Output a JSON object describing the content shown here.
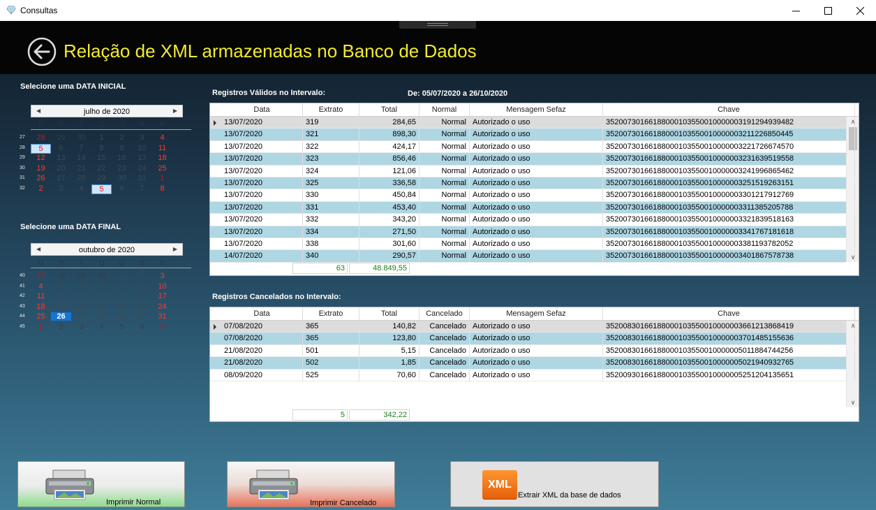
{
  "window": {
    "title": "Consultas",
    "controls": [
      "minimize",
      "maximize",
      "close"
    ]
  },
  "header": {
    "title": "Relação de XML armazenadas no Banco de Dados",
    "back_icon": "arrow-left-circle-icon"
  },
  "calendar_start": {
    "label": "Selecione uma DATA INICIAL",
    "month_title": "julho de 2020",
    "weekday_headers": [
      "D",
      "S",
      "T",
      "Q",
      "Q",
      "S",
      "S"
    ],
    "weeks": [
      {
        "week": "27",
        "days": [
          "28",
          "29",
          "30",
          "1",
          "2",
          "3",
          "4"
        ]
      },
      {
        "week": "28",
        "days": [
          "5",
          "6",
          "7",
          "8",
          "9",
          "10",
          "11"
        ]
      },
      {
        "week": "29",
        "days": [
          "12",
          "13",
          "14",
          "15",
          "16",
          "17",
          "18"
        ]
      },
      {
        "week": "30",
        "days": [
          "19",
          "20",
          "21",
          "22",
          "23",
          "24",
          "25"
        ]
      },
      {
        "week": "31",
        "days": [
          "26",
          "27",
          "28",
          "29",
          "30",
          "31",
          "1"
        ]
      },
      {
        "week": "32",
        "days": [
          "2",
          "3",
          "4",
          "5",
          "6",
          "7",
          "8"
        ]
      }
    ],
    "selected_day": "5"
  },
  "calendar_end": {
    "label": "Selecione uma DATA FINAL",
    "month_title": "outubro de 2020",
    "weekday_headers": [
      "D",
      "S",
      "T",
      "Q",
      "Q",
      "S",
      "S"
    ],
    "weeks": [
      {
        "week": "40",
        "days": [
          "27",
          "28",
          "29",
          "30",
          "1",
          "2",
          "3"
        ]
      },
      {
        "week": "41",
        "days": [
          "4",
          "5",
          "6",
          "7",
          "8",
          "9",
          "10"
        ]
      },
      {
        "week": "42",
        "days": [
          "11",
          "12",
          "13",
          "14",
          "15",
          "16",
          "17"
        ]
      },
      {
        "week": "43",
        "days": [
          "18",
          "19",
          "20",
          "21",
          "22",
          "23",
          "24"
        ]
      },
      {
        "week": "44",
        "days": [
          "25",
          "26",
          "27",
          "28",
          "29",
          "30",
          "31"
        ]
      },
      {
        "week": "45",
        "days": [
          "1",
          "2",
          "3",
          "4",
          "5",
          "6",
          "7"
        ]
      }
    ],
    "selected_day": "26"
  },
  "valid_section": {
    "label": "Registros Válidos no Intervalo:",
    "range": "De: 05/07/2020 a 26/10/2020",
    "columns": [
      "Data",
      "Extrato",
      "Total",
      "Normal",
      "Mensagem Sefaz",
      "Chave"
    ],
    "rows": [
      [
        "13/07/2020",
        "319",
        "284,65",
        "Normal",
        "Autorizado o uso",
        "35200730166188000103550010000003191294939482"
      ],
      [
        "13/07/2020",
        "321",
        "898,30",
        "Normal",
        "Autorizado o uso",
        "35200730166188000103550010000003211226850445"
      ],
      [
        "13/07/2020",
        "322",
        "424,17",
        "Normal",
        "Autorizado o uso",
        "35200730166188000103550010000003221726674570"
      ],
      [
        "13/07/2020",
        "323",
        "856,46",
        "Normal",
        "Autorizado o uso",
        "35200730166188000103550010000003231639519558"
      ],
      [
        "13/07/2020",
        "324",
        "121,06",
        "Normal",
        "Autorizado o uso",
        "35200730166188000103550010000003241996865462"
      ],
      [
        "13/07/2020",
        "325",
        "336,58",
        "Normal",
        "Autorizado o uso",
        "35200730166188000103550010000003251519263151"
      ],
      [
        "13/07/2020",
        "330",
        "450,84",
        "Normal",
        "Autorizado o uso",
        "35200730166188000103550010000003301217912769"
      ],
      [
        "13/07/2020",
        "331",
        "453,40",
        "Normal",
        "Autorizado o uso",
        "35200730166188000103550010000003311385205788"
      ],
      [
        "13/07/2020",
        "332",
        "343,20",
        "Normal",
        "Autorizado o uso",
        "35200730166188000103550010000003321839518163"
      ],
      [
        "13/07/2020",
        "334",
        "271,50",
        "Normal",
        "Autorizado o uso",
        "35200730166188000103550010000003341767181618"
      ],
      [
        "13/07/2020",
        "338",
        "301,60",
        "Normal",
        "Autorizado o uso",
        "35200730166188000103550010000003381193782052"
      ],
      [
        "14/07/2020",
        "340",
        "290,57",
        "Normal",
        "Autorizado o uso",
        "35200730166188000103550010000003401867578738"
      ]
    ],
    "total_count": "63",
    "total_value": "48.849,55"
  },
  "cancel_section": {
    "label": "Registros Cancelados no Intervalo:",
    "columns": [
      "Data",
      "Extrato",
      "Total",
      "Cancelado",
      "Mensagem Sefaz",
      "Chave"
    ],
    "rows": [
      [
        "07/08/2020",
        "365",
        "140,82",
        "Cancelado",
        "Autorizado o uso",
        "35200830166188000103550010000003661213868419"
      ],
      [
        "07/08/2020",
        "365",
        "123,80",
        "Cancelado",
        "Autorizado o uso",
        "35200830166188000103550010000003701485155636"
      ],
      [
        "21/08/2020",
        "501",
        "5,15",
        "Cancelado",
        "Autorizado o uso",
        "35200830166188000103550010000005011884744256"
      ],
      [
        "21/08/2020",
        "502",
        "1,85",
        "Cancelado",
        "Autorizado o uso",
        "35200830166188000103550010000005021940932765"
      ],
      [
        "08/09/2020",
        "525",
        "70,60",
        "Cancelado",
        "Autorizado o uso",
        "35200930166188000103550010000005251204135651"
      ]
    ],
    "total_count": "5",
    "total_value": "342,22"
  },
  "buttons": {
    "print_normal": "Imprimir Normal",
    "print_cancel": "Imprimir Cancelado",
    "extract_xml": "Extrair XML da base de dados",
    "xml_badge": "XML"
  },
  "colors": {
    "title_yellow": "#f2ec2a",
    "row_alt": "#aed6e3",
    "total_green": "#1d7f1d",
    "sunday_red": "#ff3a2a",
    "today_blue": "#1476d6"
  }
}
